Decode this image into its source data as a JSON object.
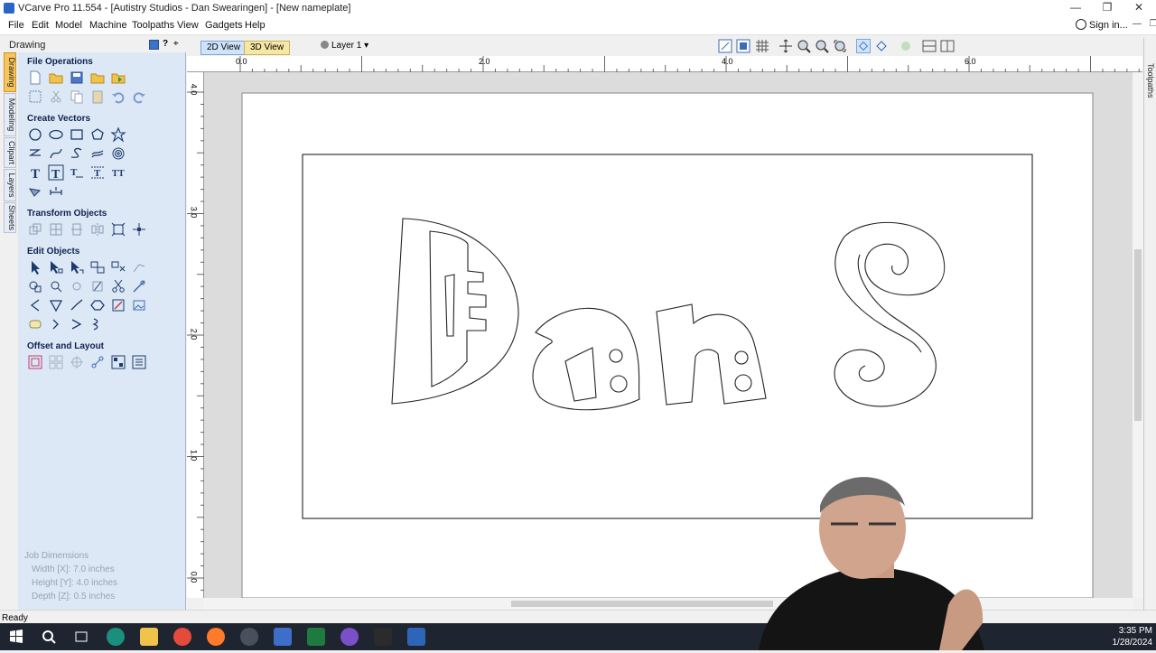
{
  "window": {
    "title": "VCarve Pro 11.554 - [Autistry Studios - Dan Swearingen] - [New nameplate]",
    "controls": [
      "—",
      "❐",
      "✕"
    ]
  },
  "menu": {
    "items": [
      "File",
      "Edit",
      "Model",
      "Machine",
      "Toolpaths",
      "View",
      "Gadgets",
      "Help"
    ],
    "signin": "Sign in..."
  },
  "panel": {
    "header": "Drawing",
    "header_buttons": [
      "?",
      "⌖"
    ],
    "side_tabs": [
      "Drawing",
      "Modeling",
      "Clipart",
      "Layers",
      "Sheets"
    ],
    "sections": [
      {
        "title": "File Operations"
      },
      {
        "title": "Create Vectors"
      },
      {
        "title": "Transform Objects"
      },
      {
        "title": "Edit Objects"
      },
      {
        "title": "Offset and Layout"
      }
    ],
    "job_dimensions": {
      "title": "Job Dimensions",
      "width": "Width  [X]: 7.0 inches",
      "height": "Height [Y]: 4.0 inches",
      "depth": "Depth  [Z]: 0.5 inches"
    }
  },
  "view": {
    "tab_2d": "2D View",
    "tab_3d": "3D View",
    "layer": "Layer 1",
    "ruler_h": [
      "0.0",
      "2.0",
      "4.0",
      "6.0"
    ],
    "ruler_v": [
      "4.0",
      "3.0",
      "2.0",
      "1.0",
      "0.0"
    ]
  },
  "right_strip": "Toolpaths",
  "status": "Ready",
  "clock": {
    "time": "3:35 PM",
    "date": "1/28/2024"
  },
  "colors": {
    "panel_bg": "#dce8f5",
    "active_tab": "#f7c55a",
    "taskbar": "#1f2530"
  }
}
